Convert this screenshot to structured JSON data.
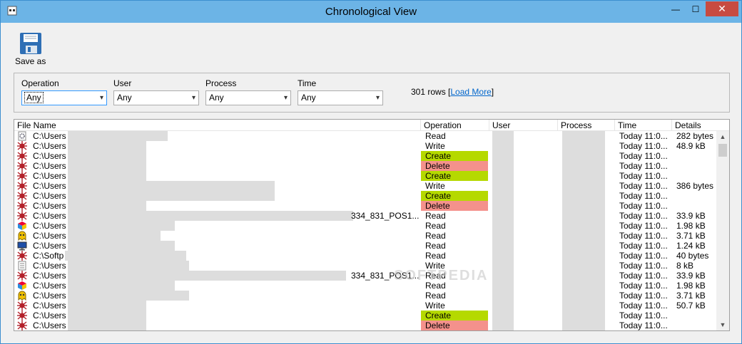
{
  "window": {
    "title": "Chronological View",
    "minimize": "—",
    "maximize": "☐",
    "close": "✕"
  },
  "toolbar": {
    "save_label": "Save as"
  },
  "filters": {
    "operation": {
      "label": "Operation",
      "value": "Any"
    },
    "user": {
      "label": "User",
      "value": "Any"
    },
    "process": {
      "label": "Process",
      "value": "Any"
    },
    "time": {
      "label": "Time",
      "value": "Any"
    },
    "rows_text": "301 rows",
    "load_more": "Load More"
  },
  "columns": {
    "file_name": "File Name",
    "operation": "Operation",
    "user": "User",
    "process": "Process",
    "time": "Time",
    "details": "Details"
  },
  "watermark": "SOFTPEDIA",
  "rows": [
    {
      "icon": "gear-file-icon",
      "name": "C:\\Users",
      "suffix": "",
      "op": "Read",
      "time": "Today 11:0...",
      "details": "282 bytes"
    },
    {
      "icon": "red-bug-icon",
      "name": "C:\\Users",
      "suffix": "",
      "op": "Write",
      "time": "Today 11:0...",
      "details": "48.9 kB"
    },
    {
      "icon": "red-bug-icon",
      "name": "C:\\Users",
      "suffix": "",
      "op": "Create",
      "time": "Today 11:0...",
      "details": ""
    },
    {
      "icon": "red-bug-icon",
      "name": "C:\\Users",
      "suffix": "",
      "op": "Delete",
      "time": "Today 11:0...",
      "details": ""
    },
    {
      "icon": "red-bug-icon",
      "name": "C:\\Users",
      "suffix": "",
      "op": "Create",
      "time": "Today 11:0...",
      "details": ""
    },
    {
      "icon": "red-bug-icon",
      "name": "C:\\Users",
      "suffix": "",
      "op": "Write",
      "time": "Today 11:0...",
      "details": "386 bytes"
    },
    {
      "icon": "red-bug-icon",
      "name": "C:\\Users",
      "suffix": "",
      "op": "Create",
      "time": "Today 11:0...",
      "details": ""
    },
    {
      "icon": "red-bug-icon",
      "name": "C:\\Users",
      "suffix": "",
      "op": "Delete",
      "time": "Today 11:0...",
      "details": ""
    },
    {
      "icon": "red-bug-icon",
      "name": "C:\\Users",
      "suffix": "334_831_POS1...",
      "op": "Read",
      "time": "Today 11:0...",
      "details": "33.9 kB"
    },
    {
      "icon": "color-cube-icon",
      "name": "C:\\Users",
      "suffix": "",
      "op": "Read",
      "time": "Today 11:0...",
      "details": "1.98 kB"
    },
    {
      "icon": "yellow-ghost-icon",
      "name": "C:\\Users",
      "suffix": "",
      "op": "Read",
      "time": "Today 11:0...",
      "details": "3.71 kB"
    },
    {
      "icon": "monitor-icon",
      "name": "C:\\Users",
      "suffix": "",
      "op": "Read",
      "time": "Today 11:0...",
      "details": "1.24 kB"
    },
    {
      "icon": "red-bug-icon",
      "name": "C:\\Softp",
      "suffix": "",
      "op": "Read",
      "time": "Today 11:0...",
      "details": "40 bytes"
    },
    {
      "icon": "text-file-icon",
      "name": "C:\\Users",
      "suffix": "",
      "op": "Write",
      "time": "Today 11:0...",
      "details": "8 kB"
    },
    {
      "icon": "red-bug-icon",
      "name": "C:\\Users",
      "suffix": "334_831_POS1...",
      "op": "Read",
      "time": "Today 11:0...",
      "details": "33.9 kB"
    },
    {
      "icon": "color-cube-icon",
      "name": "C:\\Users",
      "suffix": "",
      "op": "Read",
      "time": "Today 11:0...",
      "details": "1.98 kB"
    },
    {
      "icon": "yellow-ghost-icon",
      "name": "C:\\Users",
      "suffix": "",
      "op": "Read",
      "time": "Today 11:0...",
      "details": "3.71 kB"
    },
    {
      "icon": "red-bug-icon",
      "name": "C:\\Users",
      "suffix": "",
      "op": "Write",
      "time": "Today 11:0...",
      "details": "50.7 kB"
    },
    {
      "icon": "red-bug-icon",
      "name": "C:\\Users",
      "suffix": "",
      "op": "Create",
      "time": "Today 11:0...",
      "details": ""
    },
    {
      "icon": "red-bug-icon",
      "name": "C:\\Users",
      "suffix": "",
      "op": "Delete",
      "time": "Today 11:0...",
      "details": ""
    }
  ],
  "colors": {
    "create": "#b5d900",
    "delete": "#f4918c",
    "titlebar": "#6cb4e6",
    "link": "#0066cc"
  }
}
